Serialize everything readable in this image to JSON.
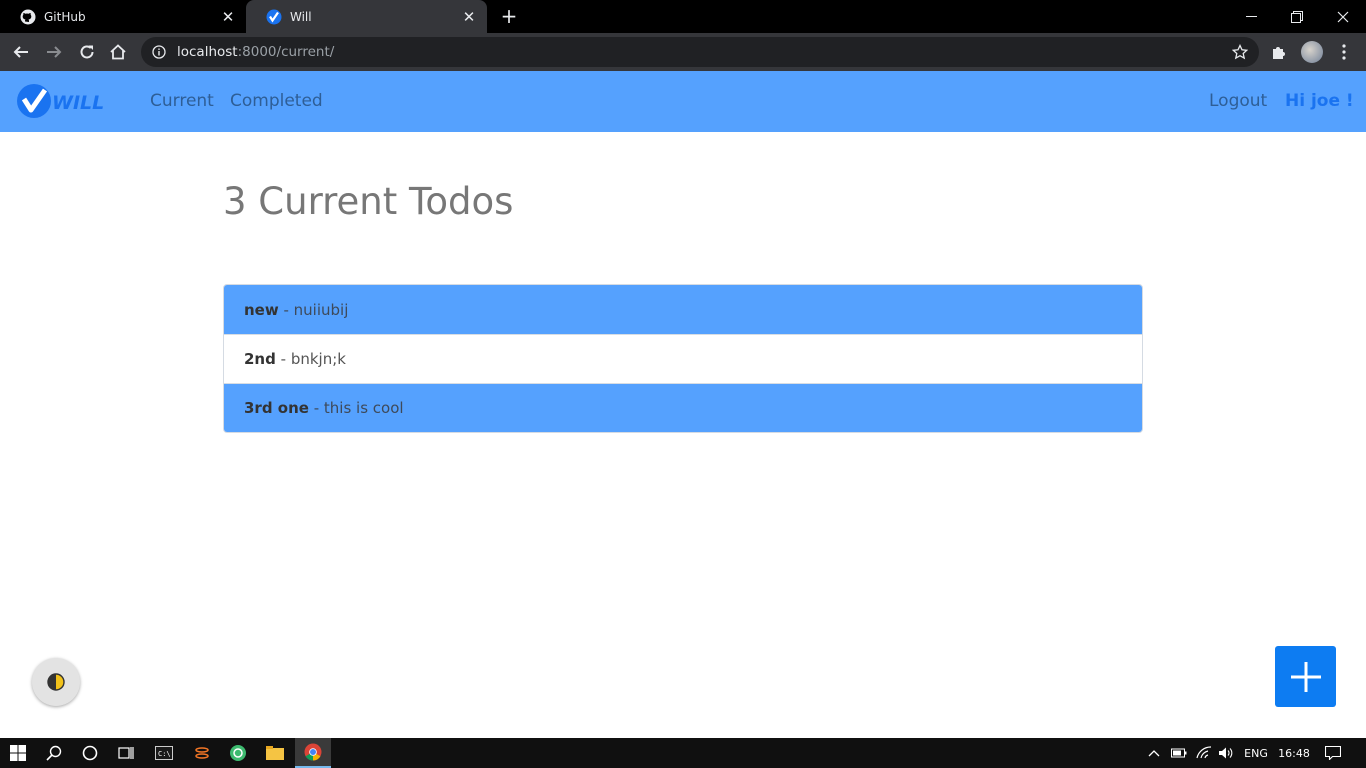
{
  "browser": {
    "tabs": [
      {
        "title": "GitHub",
        "icon": "github-icon",
        "active": false
      },
      {
        "title": "Will",
        "icon": "will-favicon",
        "active": true
      }
    ],
    "address": {
      "host": "localhost",
      "path": ":8000/current/"
    }
  },
  "navbar": {
    "brand": "WILL",
    "links": [
      "Current",
      "Completed"
    ],
    "logout": "Logout",
    "greeting": "Hi joe !"
  },
  "main": {
    "title": "3 Current Todos",
    "todos": [
      {
        "name": "new",
        "separator": " - ",
        "description": "nuiiubij",
        "highlight": true
      },
      {
        "name": "2nd",
        "separator": " - ",
        "description": "bnkjn;k",
        "highlight": false
      },
      {
        "name": "3rd one",
        "separator": " - ",
        "description": "this is cool",
        "highlight": true
      }
    ]
  },
  "taskbar": {
    "language": "ENG",
    "time": "16:48"
  },
  "colors": {
    "navbar_bg": "#55a1fe",
    "highlight_row": "#55a1fe",
    "fab_bg": "#0d7cf2",
    "greeting": "#1a73f0"
  }
}
